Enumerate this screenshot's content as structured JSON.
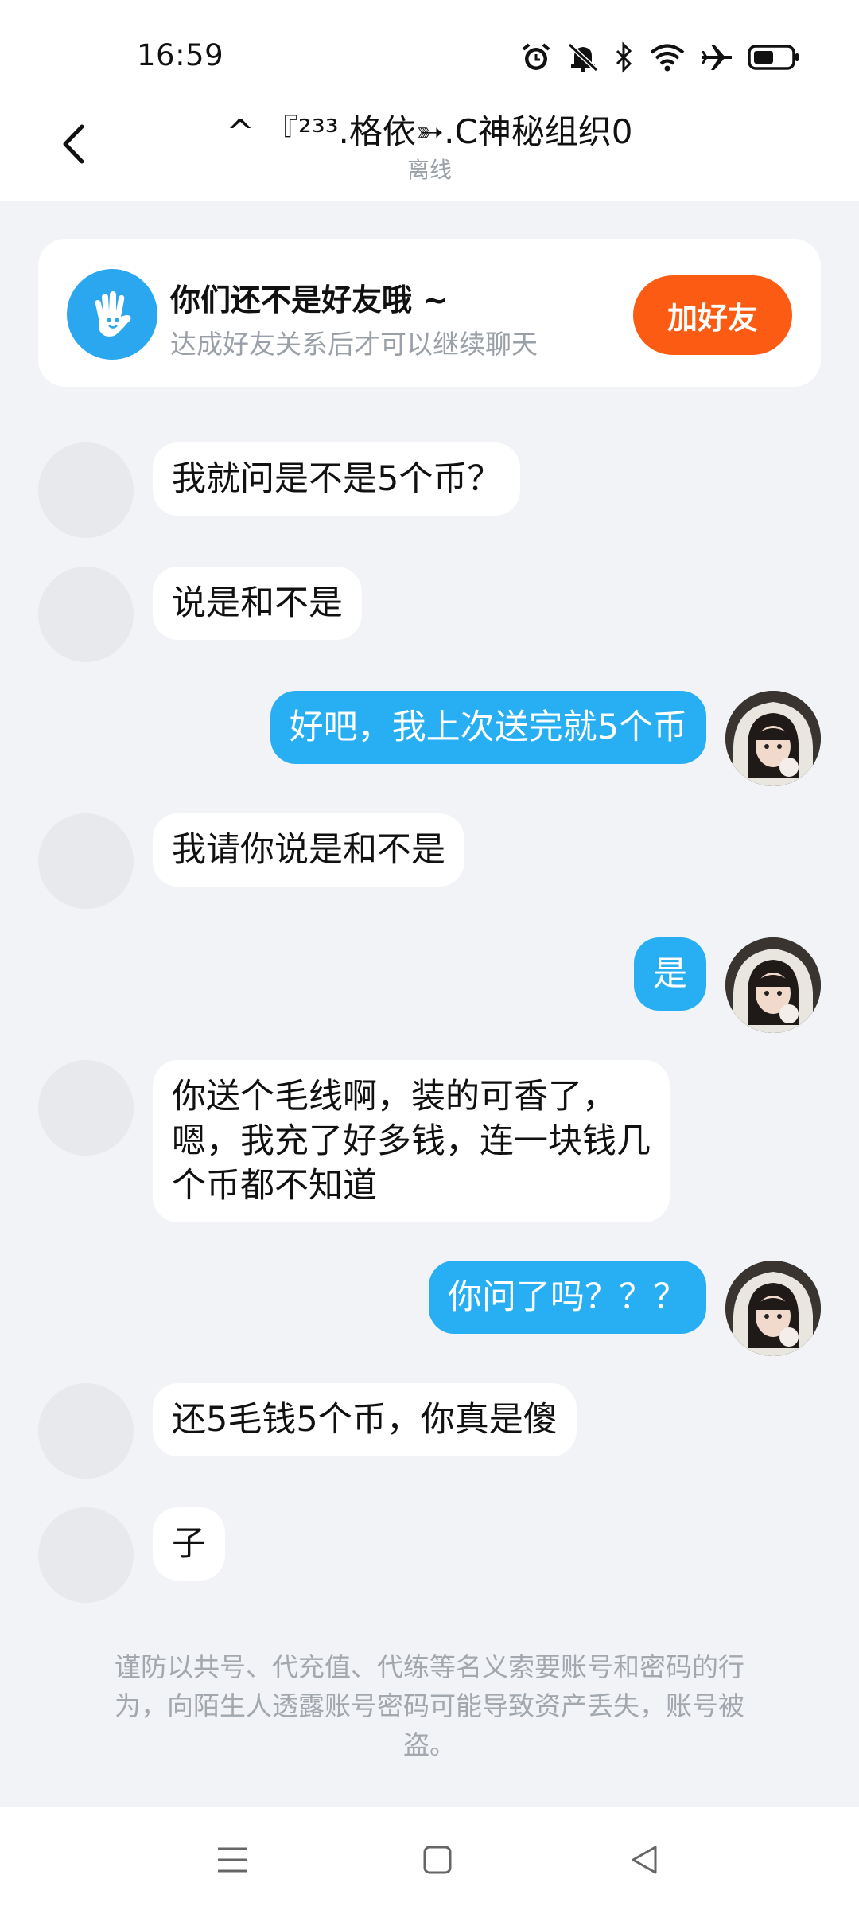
{
  "status": {
    "time": "16:59"
  },
  "header": {
    "title": "^ 『²³³.格依➳.C神秘组织0",
    "subtitle": "离线"
  },
  "friend_card": {
    "title": "你们还不是好友哦 ~",
    "subtitle": "达成好友关系后才可以继续聊天",
    "button": "加好友"
  },
  "messages": [
    {
      "side": "left",
      "lines": [
        "我就问是不是5个币？"
      ]
    },
    {
      "side": "left",
      "lines": [
        "说是和不是"
      ]
    },
    {
      "side": "right",
      "lines": [
        "好吧，我上次送完就5个币"
      ]
    },
    {
      "side": "left",
      "lines": [
        "我请你说是和不是"
      ]
    },
    {
      "side": "right",
      "lines": [
        "是"
      ]
    },
    {
      "side": "left",
      "lines": [
        "你送个毛线啊，装的可香了，",
        "嗯，我充了好多钱，连一块钱几",
        "个币都不知道"
      ]
    },
    {
      "side": "right",
      "lines": [
        "你问了吗？？？"
      ]
    },
    {
      "side": "left",
      "lines": [
        "还5毛钱5个币，你真是傻"
      ]
    },
    {
      "side": "left",
      "lines": [
        "子"
      ]
    }
  ],
  "warning": {
    "lines": [
      "谨防以共号、代充值、代练等名义索要账号和密码的行",
      "为，向陌生人透露账号密码可能导致资产丢失，账号被",
      "盗。"
    ]
  },
  "icons": {
    "back": "back-arrow-icon",
    "hand": "waving-hand-icon",
    "nav_menu": "menu-icon",
    "nav_home": "home-square-icon",
    "nav_back": "back-triangle-icon"
  },
  "colors": {
    "accent_blue": "#27aef3",
    "button_orange": "#fb5b12",
    "background": "#f1f3f6"
  }
}
